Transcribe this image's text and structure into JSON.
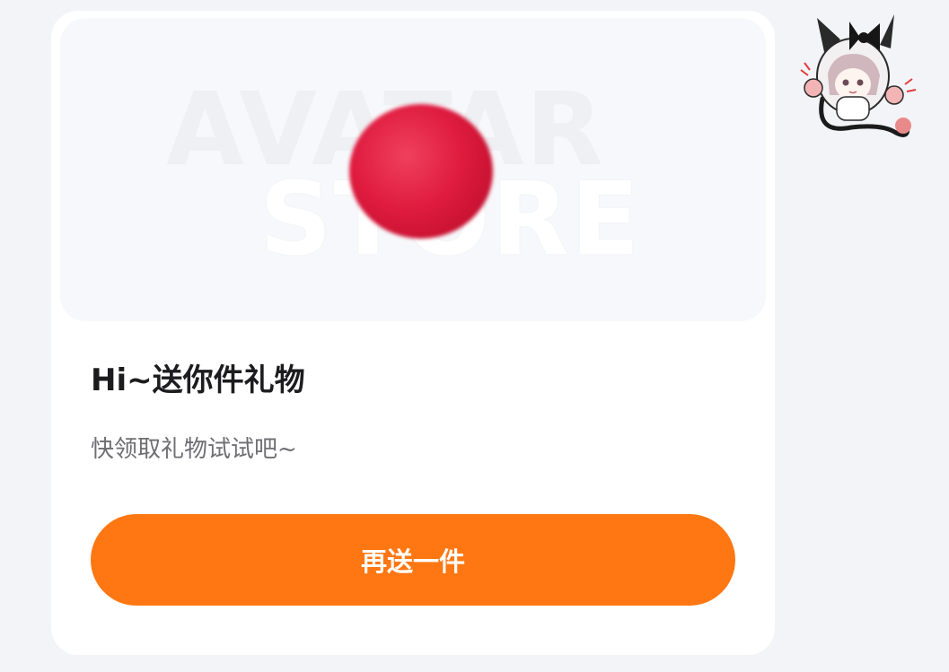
{
  "banner": {
    "watermark_line1": "AVATAR",
    "watermark_line2": "STORE"
  },
  "gift": {
    "title": "Hi~送你件礼物",
    "subtitle": "快领取礼物试试吧~",
    "button_label": "再送一件"
  },
  "colors": {
    "accent": "#ff7712",
    "gift": "#df1c3f"
  },
  "icons": {
    "gift_image": "red-pompom-gift",
    "avatar": "anime-cat-girl-sticker"
  }
}
